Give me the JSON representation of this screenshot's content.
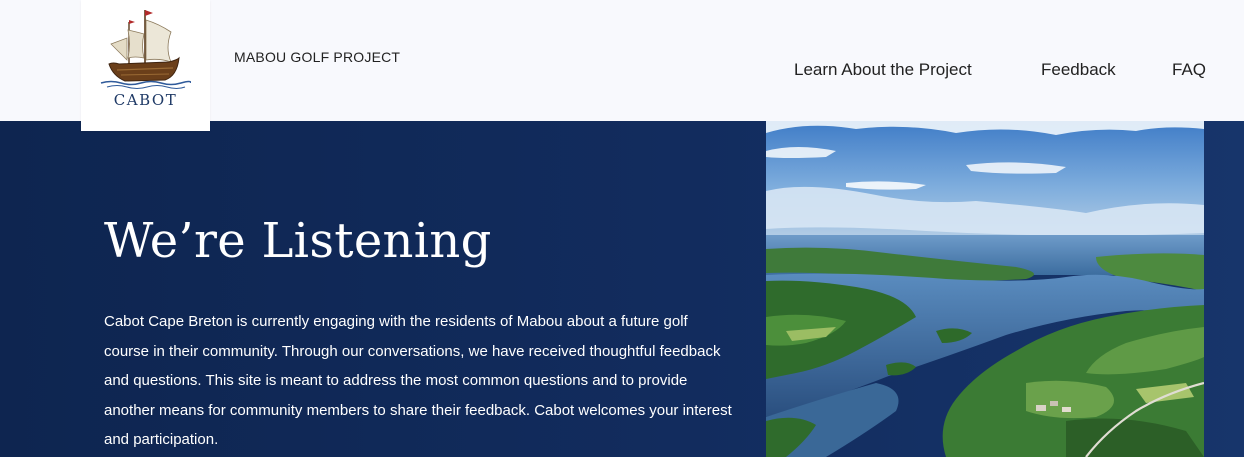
{
  "header": {
    "logo_text": "CABOT",
    "site_title": "MABOU GOLF PROJECT",
    "nav": [
      {
        "label": "Learn About the Project"
      },
      {
        "label": "Feedback"
      },
      {
        "label": "FAQ"
      }
    ]
  },
  "hero": {
    "title": "We’re Listening",
    "body": "Cabot Cape Breton is currently engaging with the residents of Mabou about a future golf course in their community. Through our conversations, we have received thoughtful feedback and questions. This site is meant to address the most common questions and to provide another means for community members to share their feedback. Cabot welcomes your interest and participation."
  },
  "colors": {
    "header_bg": "#f8f9fd",
    "hero_bg": "#0f2a5a",
    "text_light": "#ffffff",
    "text_dark": "#222222"
  }
}
